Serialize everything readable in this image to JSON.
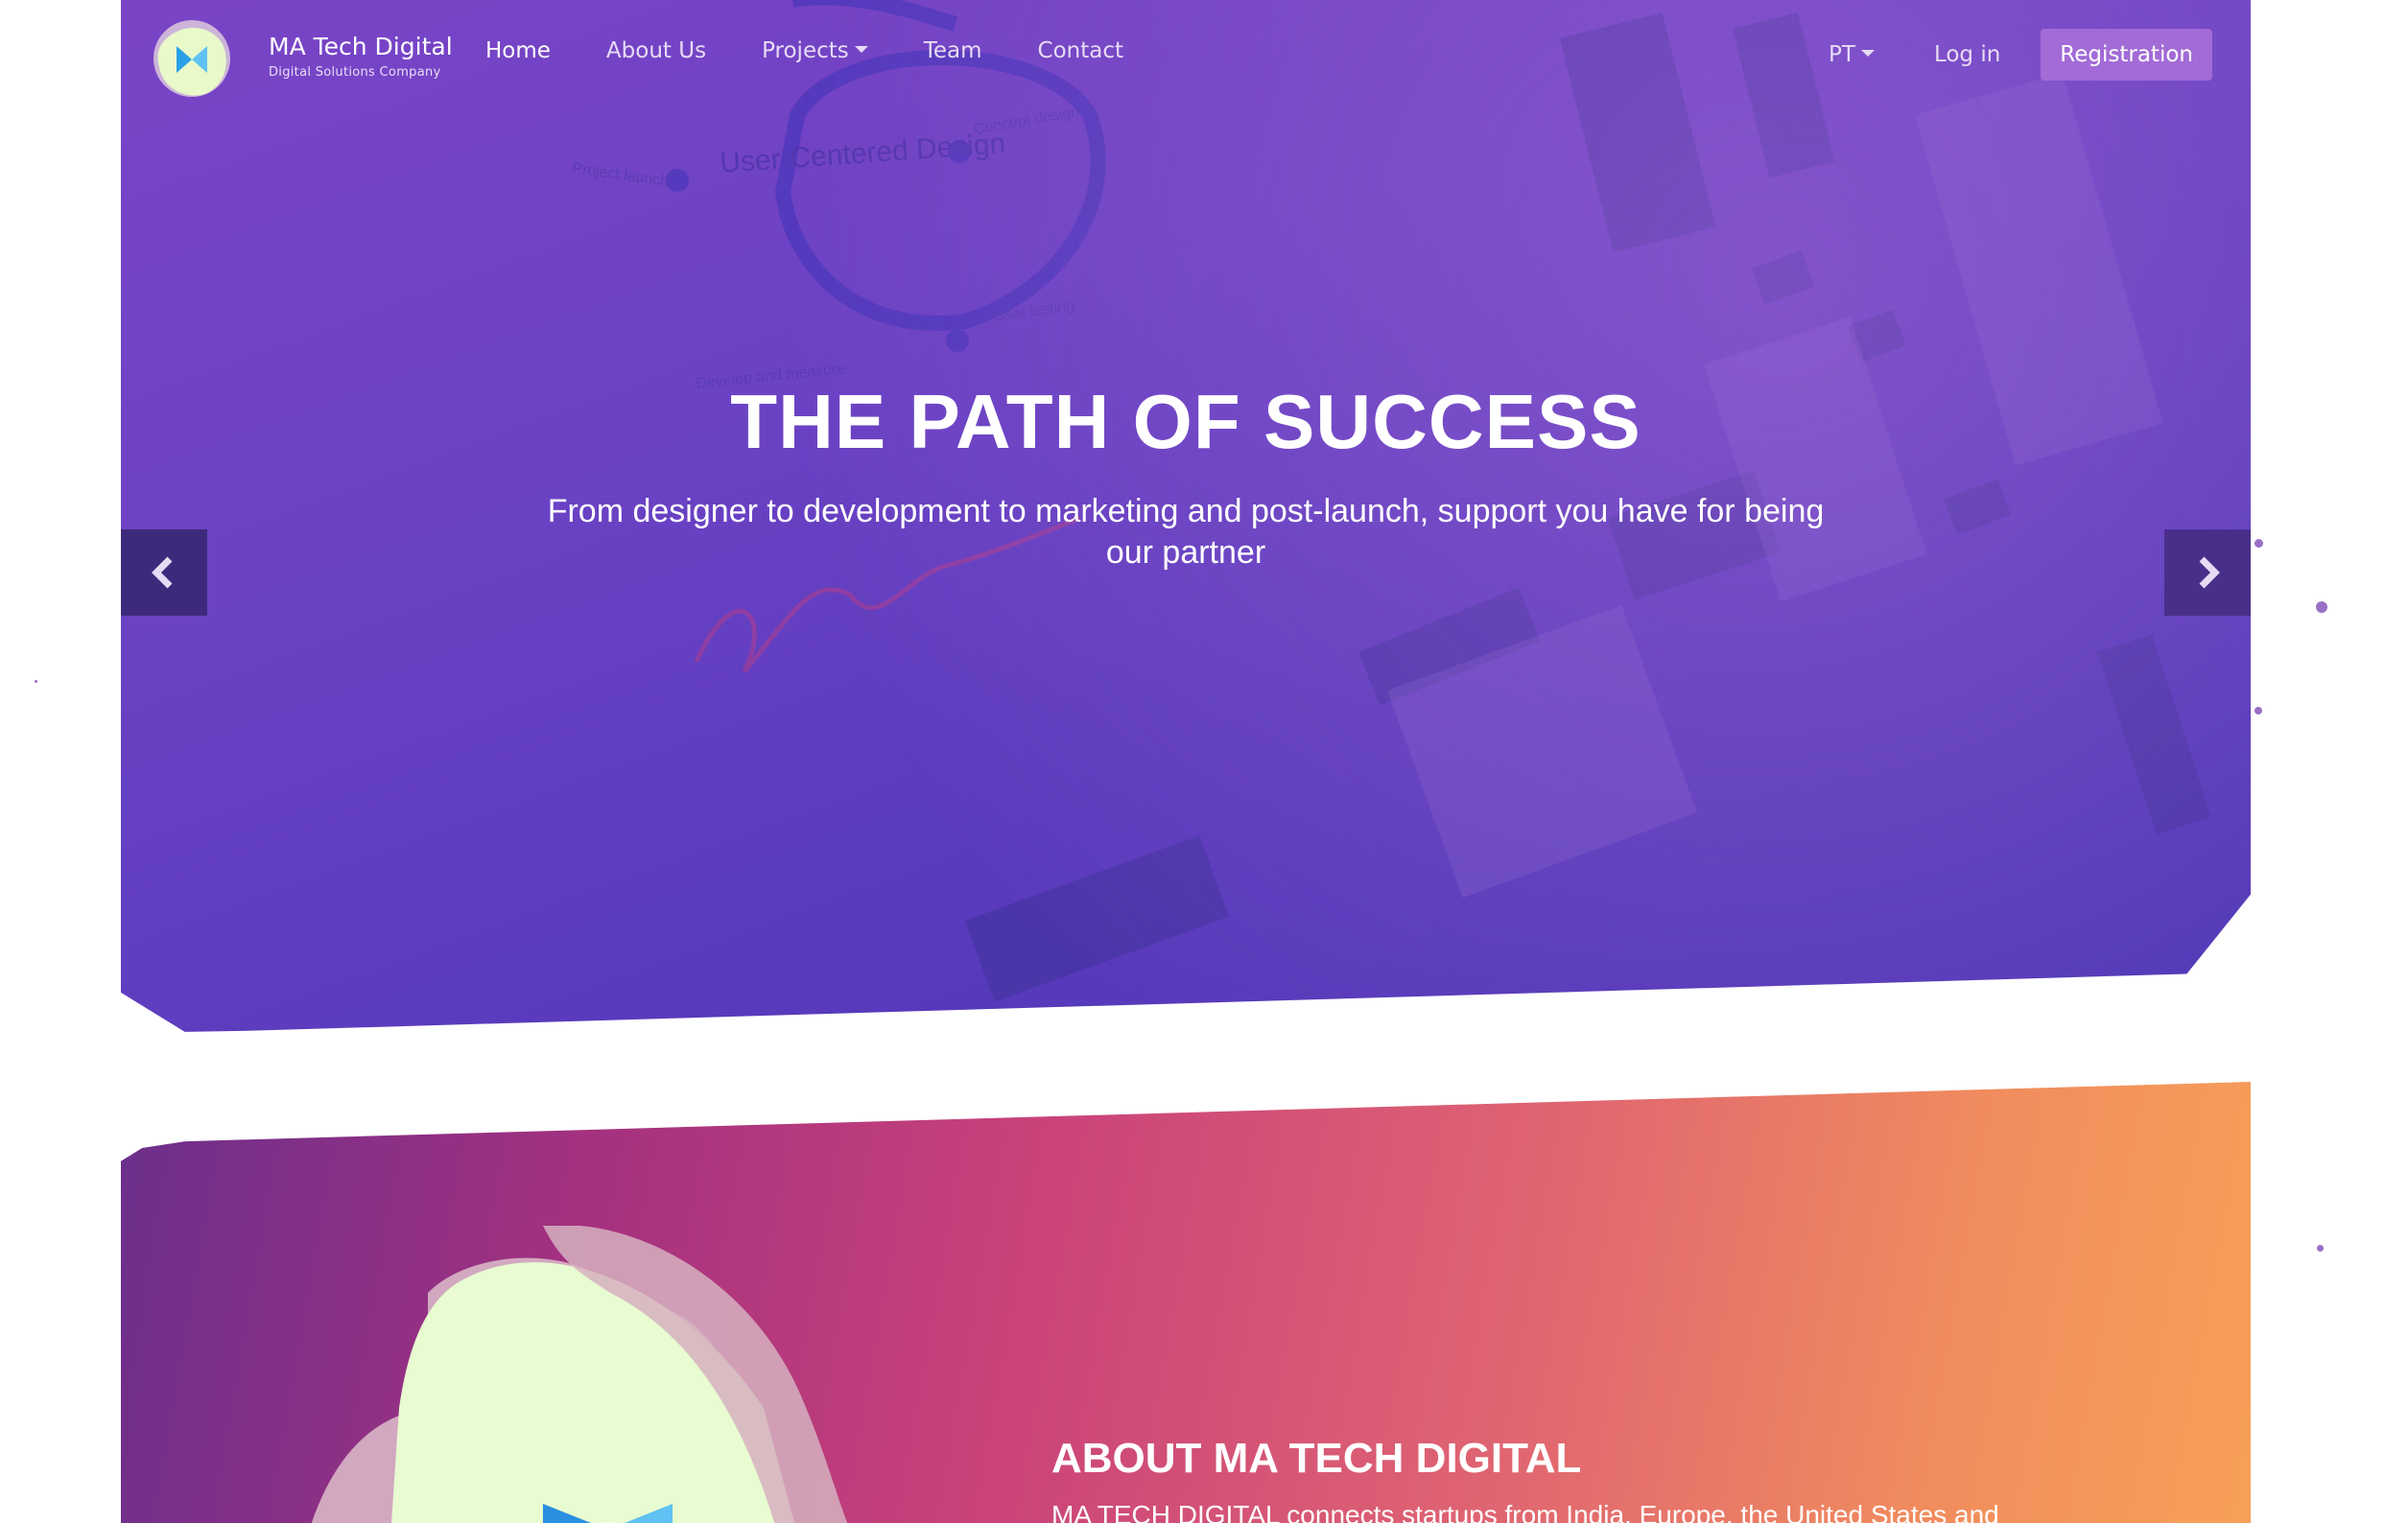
{
  "header": {
    "brand_name": "MA Tech Digital",
    "brand_tagline": "Digital Solutions Company",
    "nav": [
      {
        "label": "Home"
      },
      {
        "label": "About Us"
      },
      {
        "label": "Projects"
      },
      {
        "label": "Team"
      },
      {
        "label": "Contact"
      }
    ],
    "language": "PT",
    "login_label": "Log in",
    "register_label": "Registration"
  },
  "hero": {
    "title": "THE PATH OF SUCCESS",
    "subtitle": "From designer to development to marketing and post-launch, support you have for being our partner",
    "prev_icon": "chevron-left-icon",
    "next_icon": "chevron-right-icon",
    "background_text": {
      "diagram_title": "User-Centered Design",
      "stage_launch": "Project launch",
      "stage_concept": "Concept design",
      "stage_develop": "Develop and measure",
      "stage_testing": "User testing"
    }
  },
  "about": {
    "heading": "ABOUT MA TECH DIGITAL",
    "text": "MA TECH DIGITAL connects startups from India, Europe, the United States and"
  },
  "colors": {
    "hero_start": "#7a44c6",
    "hero_end": "#4b36b5",
    "register_bg": "#a26bd6",
    "arrow_bg": "#3e2a7c",
    "about_start": "#6a2f8c",
    "about_mid": "#c9427a",
    "about_end": "#f7a058"
  }
}
